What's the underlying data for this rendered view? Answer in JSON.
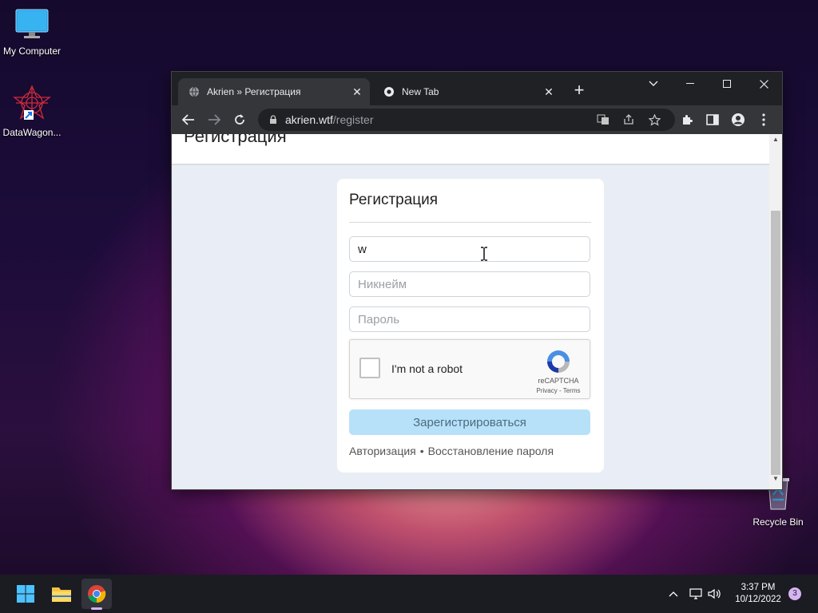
{
  "desktop": {
    "icons": [
      {
        "label": "My Computer"
      },
      {
        "label": "DataWagon..."
      },
      {
        "label": "Recycle Bin"
      }
    ]
  },
  "browser": {
    "tabs": [
      {
        "title": "Akrien » Регистрация",
        "active": true
      },
      {
        "title": "New Tab",
        "active": false
      }
    ],
    "url_host": "akrien.wtf",
    "url_path": "/register"
  },
  "page": {
    "header_title": "Регистрация",
    "card_title": "Регистрация",
    "email_value": "w",
    "nickname_placeholder": "Никнейм",
    "password_placeholder": "Пароль",
    "captcha": {
      "label": "I'm not a robot",
      "brand": "reCAPTCHA",
      "links": "Privacy - Terms"
    },
    "submit_label": "Зарегистрироваться",
    "link_login": "Авторизация",
    "link_separator": "•",
    "link_recover": "Восстановление пароля"
  },
  "taskbar": {
    "time": "3:37 PM",
    "date": "10/12/2022",
    "notification_count": "3"
  },
  "colors": {
    "submit_bg": "#b7e1f8",
    "chrome_dark": "#202124",
    "chrome_toolbar": "#35363a"
  }
}
